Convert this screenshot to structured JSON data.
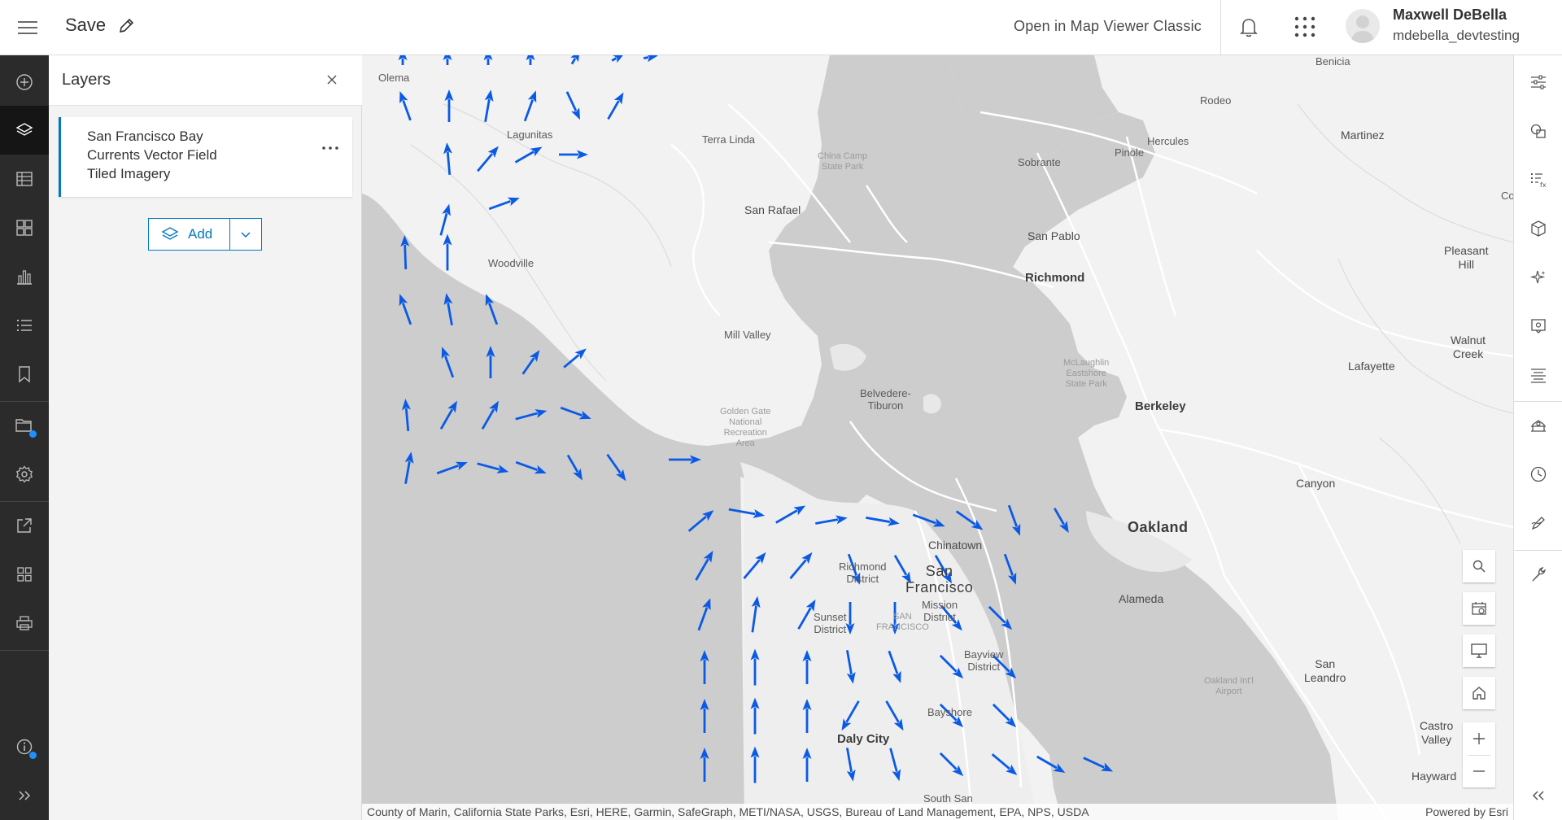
{
  "header": {
    "save_label": "Save",
    "open_classic_label": "Open in Map Viewer Classic",
    "user_name": "Maxwell DeBella",
    "user_id": "mdebella_devtesting"
  },
  "left_toolbar": {
    "items": [
      {
        "name": "add-icon"
      },
      {
        "name": "layers-icon",
        "active": true
      },
      {
        "name": "tables-icon"
      },
      {
        "name": "basemap-icon"
      },
      {
        "name": "charts-icon"
      },
      {
        "name": "legend-icon"
      },
      {
        "name": "bookmarks-icon"
      },
      {
        "name": "map-properties-icon"
      },
      {
        "name": "settings-icon"
      },
      {
        "name": "share-icon"
      },
      {
        "name": "apps-icon"
      },
      {
        "name": "print-icon"
      },
      {
        "name": "info-icon"
      },
      {
        "name": "expand-icon"
      }
    ]
  },
  "layers_panel": {
    "title": "Layers",
    "layer_lines": [
      "San Francisco Bay",
      "Currents Vector Field",
      "Tiled Imagery"
    ],
    "add_label": "Add"
  },
  "map": {
    "labels": {
      "olema": "Olema",
      "lagunitas": "Lagunitas",
      "terra_linda": "Terra Linda",
      "china_camp_1": "China Camp",
      "china_camp_2": "State Park",
      "san_rafael": "San Rafael",
      "woodville": "Woodville",
      "mill_valley": "Mill Valley",
      "belvedere_1": "Belvedere-",
      "belvedere_2": "Tiburon",
      "ggnra_1": "Golden Gate",
      "ggnra_2": "National",
      "ggnra_3": "Recreation",
      "ggnra_4": "Area",
      "benicia": "Benicia",
      "rodeo": "Rodeo",
      "martinez": "Martinez",
      "hercules": "Hercules",
      "pinole": "Pinole",
      "sobrante": "Sobrante",
      "co": "Co",
      "san_pablo": "San Pablo",
      "richmond": "Richmond",
      "pleasant_hill_1": "Pleasant",
      "pleasant_hill_2": "Hill",
      "walnut_creek_1": "Walnut",
      "walnut_creek_2": "Creek",
      "lafayette": "Lafayette",
      "mclaughlin_1": "McLaughlin",
      "mclaughlin_2": "Eastshore",
      "mclaughlin_3": "State Park",
      "berkeley": "Berkeley",
      "canyon": "Canyon",
      "oakland": "Oakland",
      "chinatown": "Chinatown",
      "richmond_district_1": "Richmond",
      "richmond_district_2": "District",
      "sf_1": "San",
      "sf_2": "Francisco",
      "sunset_1": "Sunset",
      "sunset_2": "District",
      "mission_1": "Mission",
      "mission_2": "District",
      "san_francisco_faded_1": "SAN",
      "san_francisco_faded_2": "FRANCISCO",
      "alameda": "Alameda",
      "bayview_1": "Bayview",
      "bayview_2": "District",
      "oakland_airport_1": "Oakland Int'l",
      "oakland_airport_2": "Airport",
      "san_leandro_1": "San",
      "san_leandro_2": "Leandro",
      "bayshore": "Bayshore",
      "daly_city": "Daly City",
      "castro_valley_1": "Castro",
      "castro_valley_2": "Valley",
      "hayward": "Hayward",
      "south_san": "South San"
    },
    "arrow_color": "#0a5ae6",
    "attribution": "County of Marin, California State Parks, Esri, HERE, Garmin, SafeGraph, METI/NASA, USGS, Bureau of Land Management, EPA, NPS, USDA",
    "powered_by": "Powered by Esri"
  },
  "right_toolbar": {
    "items": [
      {
        "name": "properties-icon"
      },
      {
        "name": "styles-icon"
      },
      {
        "name": "filter-icon"
      },
      {
        "name": "effects-icon"
      },
      {
        "name": "sparkle-icon"
      },
      {
        "name": "configure-popup-icon"
      },
      {
        "name": "labels-icon"
      },
      {
        "name": "fields-icon"
      },
      {
        "name": "time-icon"
      },
      {
        "name": "sketch-icon"
      },
      {
        "name": "wrench-icon"
      },
      {
        "name": "collapse-icon"
      }
    ]
  }
}
